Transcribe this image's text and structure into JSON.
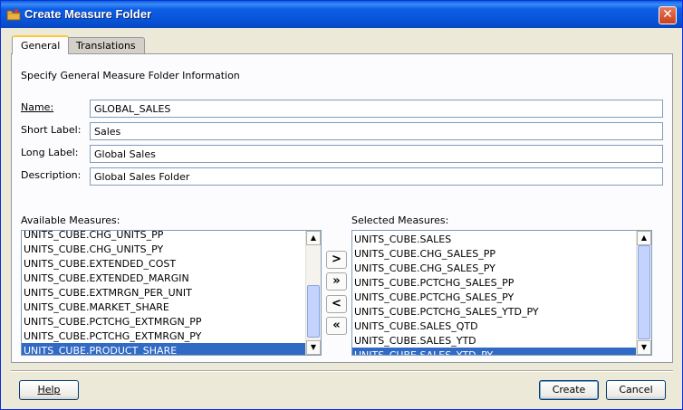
{
  "window": {
    "title": "Create Measure Folder"
  },
  "tabs": [
    {
      "label": "General",
      "active": true
    },
    {
      "label": "Translations",
      "active": false
    }
  ],
  "section_title": "Specify General Measure Folder Information",
  "fields": {
    "name": {
      "label": "Name:",
      "value": "GLOBAL_SALES"
    },
    "short_label": {
      "label": "Short Label:",
      "value": "Sales"
    },
    "long_label": {
      "label": "Long Label:",
      "value": "Global Sales"
    },
    "description": {
      "label": "Description:",
      "value": "Global Sales Folder"
    }
  },
  "available": {
    "label": "Available Measures:",
    "items": [
      "UNITS_CUBE.CHG_UNITS_PP",
      "UNITS_CUBE.CHG_UNITS_PY",
      "UNITS_CUBE.EXTENDED_COST",
      "UNITS_CUBE.EXTENDED_MARGIN",
      "UNITS_CUBE.EXTMRGN_PER_UNIT",
      "UNITS_CUBE.MARKET_SHARE",
      "UNITS_CUBE.PCTCHG_EXTMRGN_PP",
      "UNITS_CUBE.PCTCHG_EXTMRGN_PY",
      "UNITS_CUBE.PRODUCT_SHARE"
    ],
    "selected_item": "UNITS_CUBE.PRODUCT_SHARE"
  },
  "selected": {
    "label": "Selected Measures:",
    "items": [
      "UNITS_CUBE.SALES",
      "UNITS_CUBE.CHG_SALES_PP",
      "UNITS_CUBE.CHG_SALES_PY",
      "UNITS_CUBE.PCTCHG_SALES_PP",
      "UNITS_CUBE.PCTCHG_SALES_PY",
      "UNITS_CUBE.PCTCHG_SALES_YTD_PY",
      "UNITS_CUBE.SALES_QTD",
      "UNITS_CUBE.SALES_YTD",
      "UNITS_CUBE.SALES_YTD_PY"
    ],
    "selected_item": "UNITS_CUBE.SALES_YTD_PY"
  },
  "shuttle": {
    "move_one": ">",
    "move_all": "»",
    "remove_one": "<",
    "remove_all": "«"
  },
  "buttons": {
    "help": "Help",
    "create": "Create",
    "cancel": "Cancel"
  }
}
